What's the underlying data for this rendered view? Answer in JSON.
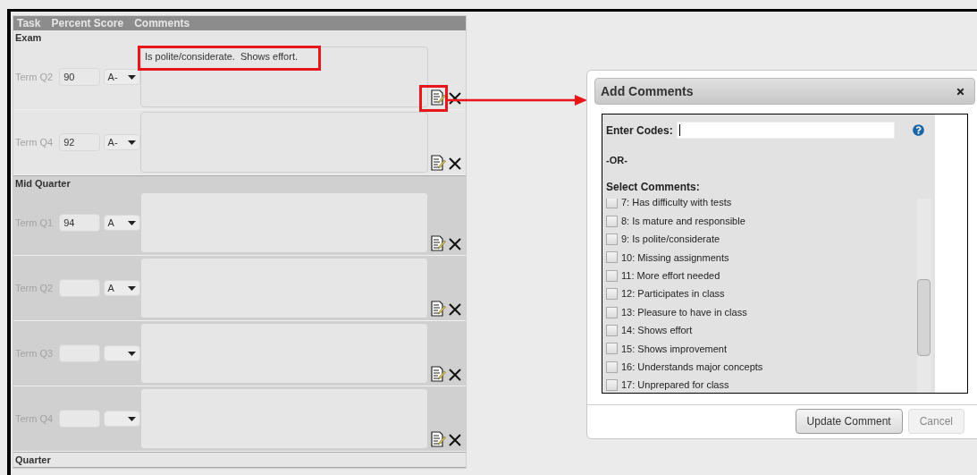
{
  "table": {
    "columns": [
      "Task",
      "Percent Score",
      "Comments"
    ],
    "sections": [
      {
        "title": "Exam",
        "kind": "plain",
        "rows": [
          {
            "term": "Term Q2",
            "score": "90",
            "grade": "A-",
            "comment": "Is polite/considerate.  Shows effort.",
            "highlighted": true
          },
          {
            "term": "Term Q4",
            "score": "92",
            "grade": "A-",
            "highlighted": false
          }
        ]
      },
      {
        "title": "Mid Quarter",
        "kind": "shaded",
        "rows": [
          {
            "term": "Term Q1",
            "score": "94",
            "grade": "A",
            "highlighted": false
          },
          {
            "term": "Term Q2",
            "grade": "A",
            "highlighted": false
          },
          {
            "term": "Term Q3",
            "highlighted": false
          },
          {
            "term": "Term Q4",
            "highlighted": false
          }
        ]
      },
      {
        "title": "Quarter",
        "kind": "plain"
      }
    ]
  },
  "dialog": {
    "title": "Add Comments",
    "codes_label": "Enter Codes:",
    "or_text": "-OR-",
    "select_label": "Select Comments:",
    "comments": [
      {
        "label": "7: Has difficulty with tests",
        "checked": false
      },
      {
        "label": "8: Is mature and responsible",
        "checked": false
      },
      {
        "label": "9: Is polite/considerate",
        "checked": false
      },
      {
        "label": "10: Missing assignments",
        "checked": false
      },
      {
        "label": "11: More effort needed",
        "checked": false
      },
      {
        "label": "12: Participates in class",
        "checked": false
      },
      {
        "label": "13: Pleasure to have in class",
        "checked": false
      },
      {
        "label": "14: Shows effort",
        "checked": false
      },
      {
        "label": "15: Shows improvement",
        "checked": false
      },
      {
        "label": "16: Understands major concepts",
        "checked": false
      },
      {
        "label": "17: Unprepared for class",
        "checked": false
      }
    ],
    "buttons": [
      {
        "label": "Update Comment",
        "disabled": false
      },
      {
        "label": "Cancel",
        "disabled": true
      }
    ]
  }
}
